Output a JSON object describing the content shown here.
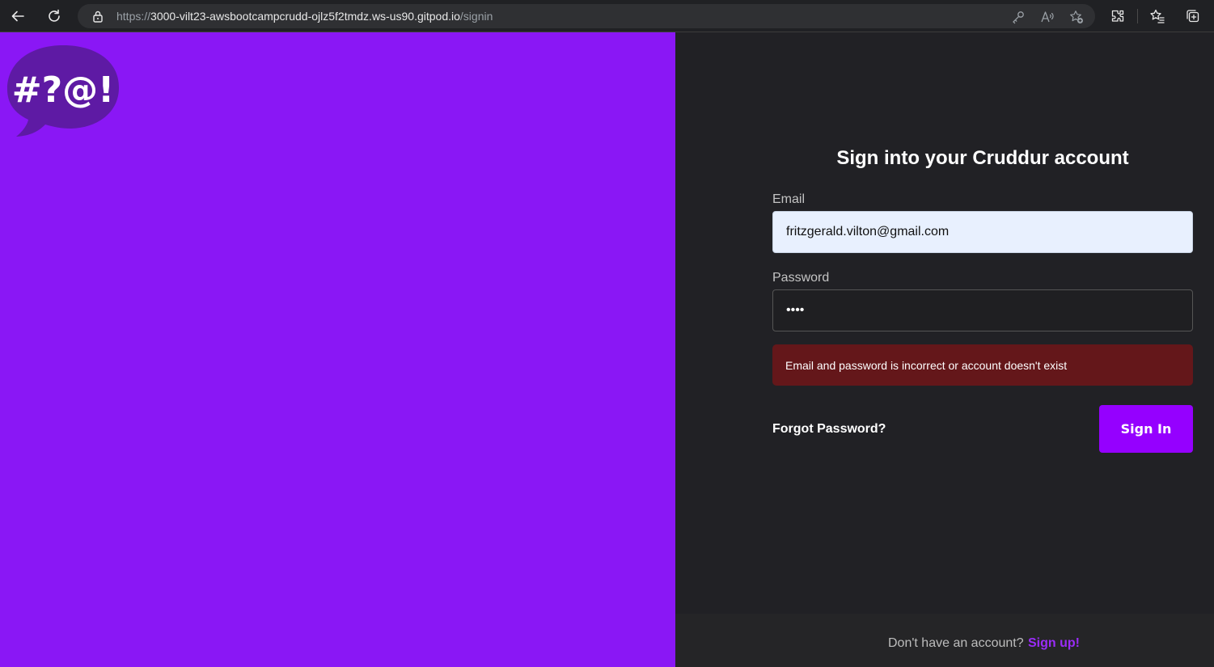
{
  "browser": {
    "url_scheme": "https://",
    "url_host": "3000-vilt23-awsbootcampcrudd-ojlz5f2tmdz.ws-us90.gitpod.io",
    "url_path": "/signin",
    "icons": [
      "back-icon",
      "refresh-icon",
      "lock-icon",
      "key-icon",
      "read-aloud-icon",
      "add-favorite-icon",
      "extensions-icon",
      "favorites-icon",
      "collections-icon"
    ]
  },
  "logo": {
    "text": "#?@!",
    "color": "#5e1aa4"
  },
  "form": {
    "title": "Sign into your Cruddur account",
    "email_label": "Email",
    "email_value": "fritzgerald.vilton@gmail.com",
    "password_label": "Password",
    "password_value": "••••",
    "error_message": "Email and password is incorrect or account doesn't exist",
    "forgot_password": "Forgot Password?",
    "signin_button": "Sign In"
  },
  "footer": {
    "prompt": "Don't have an account?",
    "signup_link": "Sign up!"
  },
  "colors": {
    "brand_purple": "#8a17f5",
    "button_purple": "#9500ff",
    "panel_dark": "#212125",
    "error_bg": "#64171a",
    "link_purple": "#9a2cf7"
  }
}
